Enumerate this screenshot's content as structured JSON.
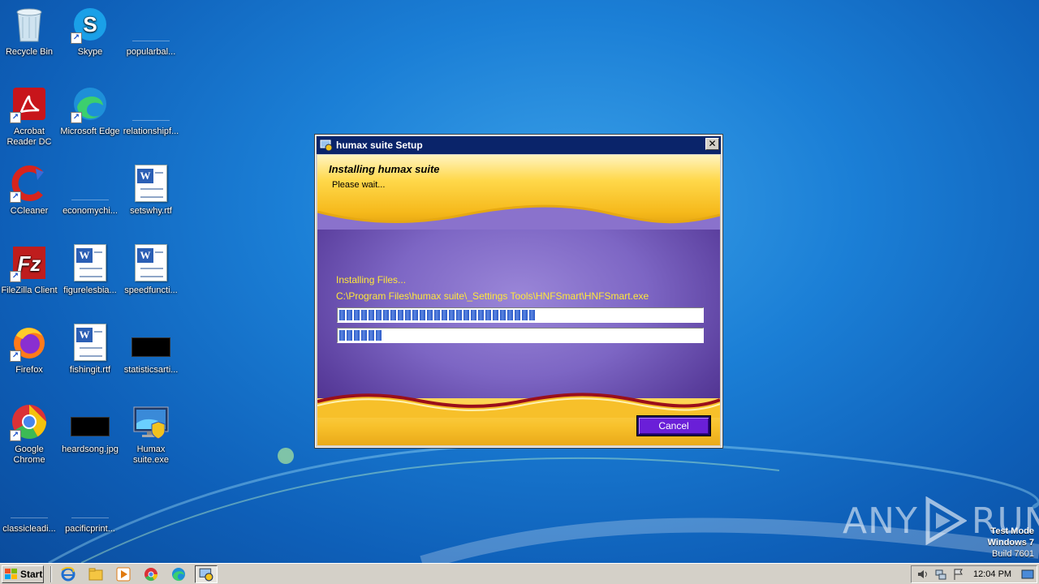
{
  "desktop": {
    "icons": [
      {
        "label": "Recycle Bin",
        "kind": "recycle-bin"
      },
      {
        "label": "Skype",
        "kind": "skype"
      },
      {
        "label": "popularbal...",
        "kind": "blank-file"
      },
      {
        "label": "Acrobat Reader DC",
        "kind": "acrobat"
      },
      {
        "label": "Microsoft Edge",
        "kind": "edge"
      },
      {
        "label": "relationshipf...",
        "kind": "blank-file"
      },
      {
        "label": "CCleaner",
        "kind": "ccleaner"
      },
      {
        "label": "economychi...",
        "kind": "blank-file"
      },
      {
        "label": "setswhy.rtf",
        "kind": "word-doc"
      },
      {
        "label": "FileZilla Client",
        "kind": "filezilla"
      },
      {
        "label": "figurelesbia...",
        "kind": "word-doc"
      },
      {
        "label": "speedfuncti...",
        "kind": "word-doc"
      },
      {
        "label": "Firefox",
        "kind": "firefox"
      },
      {
        "label": "fishingit.rtf",
        "kind": "word-doc"
      },
      {
        "label": "statisticsarti...",
        "kind": "black-image"
      },
      {
        "label": "Google Chrome",
        "kind": "chrome"
      },
      {
        "label": "heardsong.jpg",
        "kind": "black-image"
      },
      {
        "label": "Humax suite.exe",
        "kind": "installer"
      },
      {
        "label": "classicleadi...",
        "kind": "blank-file"
      },
      {
        "label": "pacificprint...",
        "kind": "blank-file"
      }
    ]
  },
  "dialog": {
    "title": "humax suite Setup",
    "close_label": "✕",
    "header_title": "Installing humax suite",
    "header_subtitle": "Please wait...",
    "status_label": "Installing Files...",
    "current_file": "C:\\Program Files\\humax suite\\_Settings Tools\\HNFSmart\\HNFSmart.exe",
    "progress_overall": 0.54,
    "progress_file": 0.12,
    "cancel_label": "Cancel"
  },
  "watermark": {
    "brand_left": "ANY",
    "brand_right": "RUN",
    "test_mode": "Test Mode",
    "os": "Windows 7",
    "build": "Build 7601"
  },
  "taskbar": {
    "start_label": "Start",
    "clock": "12:04 PM"
  },
  "colors": {
    "desktop_blue": "#1b7fd6",
    "dialog_purple": "#7d66c4",
    "dialog_gold": "#f7c02a",
    "status_yellow": "#ffe73a",
    "cancel_purple": "#6a1fd8"
  }
}
